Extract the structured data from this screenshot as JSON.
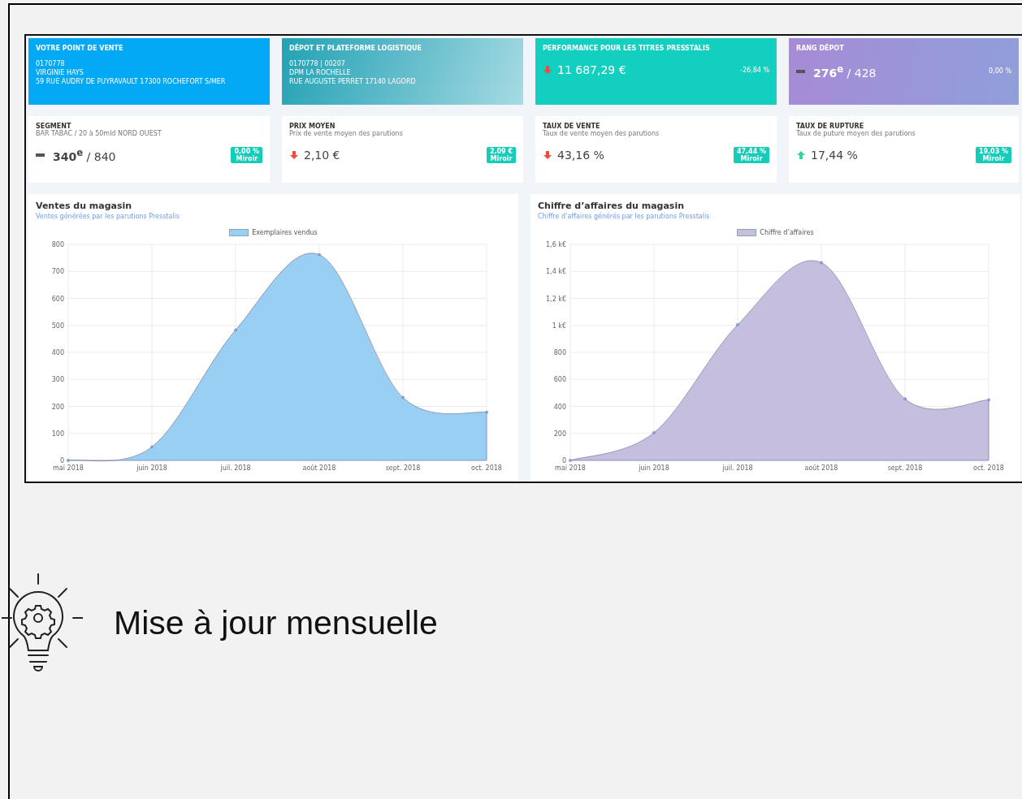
{
  "top_cards": [
    {
      "kind": "info",
      "title": "VOTRE POINT DE VENTE",
      "lines": [
        "0170778",
        "VIRGINIE HAYS",
        "59 RUE AUDRY DE PUYRAVAULT 17300 ROCHEFORT S/MER"
      ]
    },
    {
      "kind": "info",
      "title": "DÉPOT ET PLATEFORME LOGISTIQUE",
      "lines": [
        "0170778 | 00207",
        "DPM LA ROCHELLE",
        "RUE AUGUSTE PERRET 17140 LAGORD"
      ]
    },
    {
      "kind": "metric",
      "title": "PERFORMANCE POUR LES TITRES PRESSTALIS",
      "trend_up": false,
      "trend_down": true,
      "value": "11 687,29 €",
      "change": "-26,84 %"
    },
    {
      "kind": "metric",
      "title": "RANG DÉPOT",
      "trend_up": false,
      "trend_down": false,
      "value": "**276$^{e}$** / 428",
      "change": "0,00 %"
    }
  ],
  "stat_cards": [
    {
      "title": "SEGMENT",
      "subtitle": "BAR TABAC / 20 à 50mld NORD OUEST",
      "trend_up": false,
      "trend_down": false,
      "value": "**340$^{e}$** / 840",
      "badge_value": "0,00 %",
      "badge_label": "Miroir"
    },
    {
      "title": "PRIX MOYEN",
      "subtitle": "Prix de vente moyen des parutions",
      "trend_up": false,
      "trend_down": true,
      "value": "2,10 €",
      "badge_value": "2,09 €",
      "badge_label": "Miroir"
    },
    {
      "title": "TAUX DE VENTE",
      "subtitle": "Taux de vente moyen des parutions",
      "trend_up": false,
      "trend_down": true,
      "value": "43,16 %",
      "badge_value": "47,44 %",
      "badge_label": "Miroir"
    },
    {
      "title": "TAUX DE RUPTURE",
      "subtitle": "Taux de puture moyen des parutions",
      "trend_up": true,
      "trend_down": false,
      "value": "17,44 %",
      "badge_value": "19,03 %",
      "badge_label": "Miroir"
    }
  ],
  "charts": [
    {
      "title": "Ventes du magasin",
      "subtitle": "Ventes générées par les parutions Presstalis",
      "chart_data": {
        "type": "area",
        "grid": true,
        "categories": [
          "mai 2018",
          "juin 2018",
          "juil. 2018",
          "août 2018",
          "sept. 2018",
          "oct. 2018"
        ],
        "ylim": [
          0,
          800
        ],
        "yticks": [
          0,
          100,
          200,
          300,
          400,
          500,
          600,
          700,
          800
        ],
        "series": [
          {
            "name": "Exemplaires vendus",
            "color": "#9acff4",
            "values": [
              0,
              50,
              483,
              762,
              233,
              178
            ]
          }
        ]
      }
    },
    {
      "title": "Chiffre d’affaires du magasin",
      "subtitle": "Chiffre d’affaires générés par les parutions Presstalis",
      "chart_data": {
        "type": "area",
        "grid": true,
        "categories": [
          "mai 2018",
          "juin 2018",
          "juil. 2018",
          "août 2018",
          "sept. 2018",
          "oct. 2018"
        ],
        "ylim": [
          0,
          1600
        ],
        "yticks": [
          0,
          200,
          400,
          600,
          800,
          {
            "value": 1000,
            "label": "1 k€"
          },
          {
            "value": 1200,
            "label": "1,2 k€"
          },
          {
            "value": 1400,
            "label": "1,4 k€"
          },
          {
            "value": 1600,
            "label": "1,6 k€"
          }
        ],
        "series": [
          {
            "name": "Chiffre d’affaires",
            "color": "#c6bedf",
            "values": [
              0,
              205,
              1005,
              1465,
              455,
              448
            ]
          }
        ]
      }
    }
  ],
  "slide": {
    "caption": "Mise à jour mensuelle"
  }
}
